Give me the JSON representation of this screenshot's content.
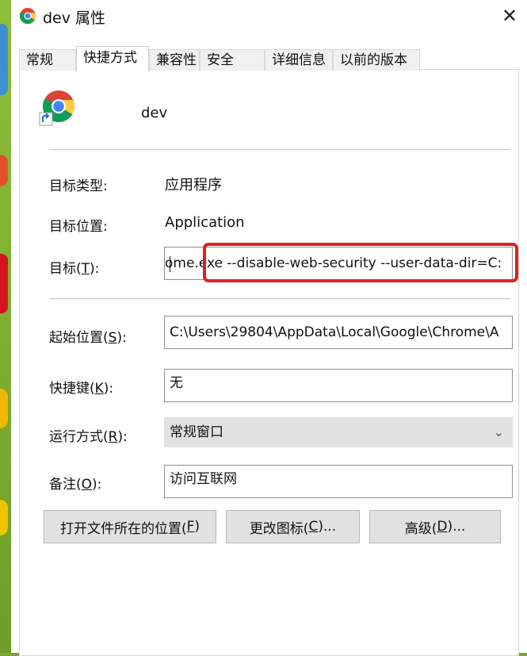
{
  "window": {
    "title": "dev 属性",
    "close_icon": "close-icon"
  },
  "tabs": [
    {
      "label": "常规"
    },
    {
      "label": "快捷方式",
      "active": true
    },
    {
      "label": "兼容性"
    },
    {
      "label": "安全"
    },
    {
      "label": "详细信息"
    },
    {
      "label": "以前的版本"
    }
  ],
  "shortcut": {
    "name": "dev",
    "icon": "chrome-shortcut-icon"
  },
  "fields": {
    "target_type_label": "目标类型:",
    "target_type_value": "应用程序",
    "target_location_label": "目标位置:",
    "target_location_value": "Application",
    "target_label_pre": "目标(",
    "target_label_key": "T",
    "target_label_post": "):",
    "target_value": "ome.exe --disable-web-security --user-data-dir=C:",
    "start_in_label_pre": "起始位置(",
    "start_in_label_key": "S",
    "start_in_label_post": "):",
    "start_in_value": "C:\\Users\\29804\\AppData\\Local\\Google\\Chrome\\A",
    "hotkey_label_pre": "快捷键(",
    "hotkey_label_key": "K",
    "hotkey_label_post": "):",
    "hotkey_value": "无",
    "run_label_pre": "运行方式(",
    "run_label_key": "R",
    "run_label_post": "):",
    "run_value": "常规窗口",
    "comment_label_pre": "备注(",
    "comment_label_key": "O",
    "comment_label_post": "):",
    "comment_value": "访问互联网"
  },
  "buttons": {
    "open_location_pre": "打开文件所在的位置(",
    "open_location_key": "F",
    "open_location_post": ")",
    "change_icon_pre": "更改图标(",
    "change_icon_key": "C",
    "change_icon_post": ")...",
    "advanced_pre": "高级(",
    "advanced_key": "D",
    "advanced_post": ")..."
  },
  "colors": {
    "highlight": "#e02020",
    "desktop": "#7aa33a"
  }
}
